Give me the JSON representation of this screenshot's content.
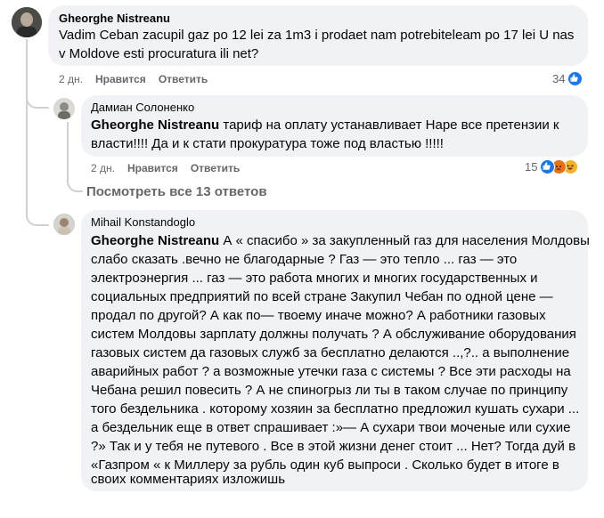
{
  "comment1": {
    "author": "Gheorghe Nistreanu",
    "lines": [
      "Vadim Ceban zacupil gaz po 12 lei za 1m3 i prodaet nam potrebiteleam po 17 lei U nas",
      "v Moldove esti procuratura ili net?"
    ],
    "time": "2 дн.",
    "like": "Нравится",
    "reply": "Ответить",
    "reaction_count": "34"
  },
  "reply1": {
    "author": "Дамиан Солоненко",
    "mention": "Gheorghe Nistreanu",
    "line1_rest": " тариф на оплату устанавливает Наре все претензии к",
    "line2": "власти!!!! Да и к стати прокуратура тоже под властью !!!!!",
    "time": "2 дн.",
    "like": "Нравится",
    "reply": "Ответить",
    "reaction_count": "15"
  },
  "view_replies": "Посмотреть все 13 ответов",
  "reply2": {
    "author": "Mihail Konstandoglo",
    "mention": "Gheorghe Nistreanu",
    "line1_rest": " А « спасибо » за закупленный газ для населения Молдовы",
    "lines": [
      "слабо сказать .вечно не благодарные ? Газ — это тепло ... газ — это",
      "электроэнергия ... газ — это работа многих и многих государственных и",
      "социальных предприятий по всей стране Закупил Чебан по одной цене —",
      "продал по другой? А как по— твоему иначе можно? А работники газовых",
      "систем Молдовы зарплату должны получать ? А обслуживание оборудования",
      "газовых систем да газовых служб за бесплатно делаются ..,?.. а выполнение",
      "аварийных работ ? а возможные утечки газа с системы ? Все эти расходы на",
      "Чебана решил повесить ? А не спиногрыз ли ты в таком случае по принципу",
      "того бездельника . которому хозяин за бесплатно предложил кушать сухари ...",
      "а бездельник еще в ответ спрашивает :»— А сухари твои моченые или сухие",
      "?» Так и у тебя не путевого . Все в этой жизни денег стоит ... Нет? Тогда дуй в",
      "«Газпром « к Миллеру за рубль один куб выпроси . Сколько будет в итоге в",
      "своих комментариях изложишь"
    ]
  },
  "colors": {
    "bubble": "#f0f2f5",
    "like_blue": "#1877f2",
    "haha_yellow": "#f7b125",
    "angry_orange": "#e9710f",
    "meta_gray": "#65676b"
  },
  "icons": {
    "like": "thumbs-up-icon",
    "angry": "angry-face-icon",
    "haha": "laughing-face-icon"
  }
}
